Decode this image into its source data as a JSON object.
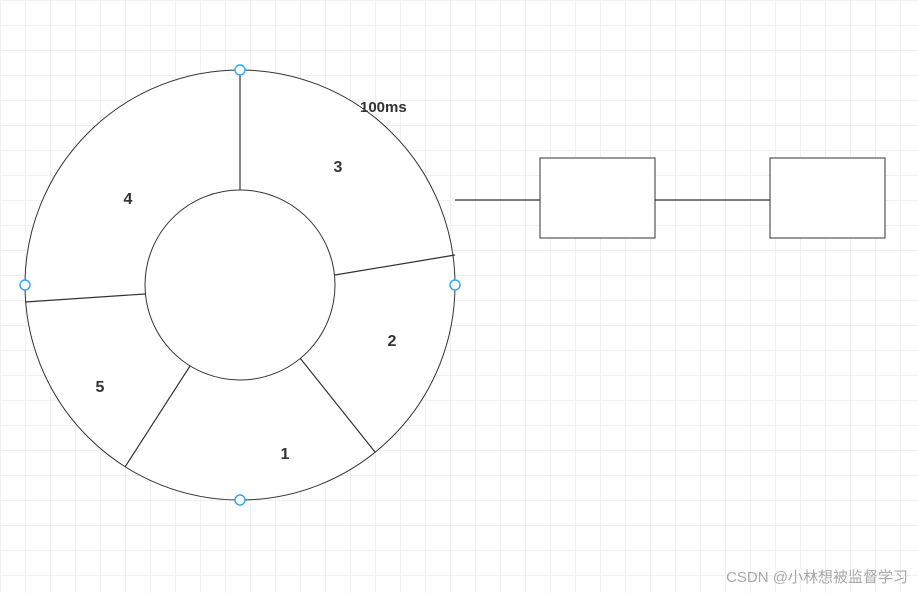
{
  "chart_data": {
    "type": "pie",
    "title": "",
    "segments": [
      {
        "label": "1"
      },
      {
        "label": "2"
      },
      {
        "label": "3"
      },
      {
        "label": "4"
      },
      {
        "label": "5"
      }
    ],
    "annotation": "100ms"
  },
  "boxes": {
    "box1": {
      "label": ""
    },
    "box2": {
      "label": ""
    }
  },
  "watermark": "CSDN @小林想被监督学习"
}
